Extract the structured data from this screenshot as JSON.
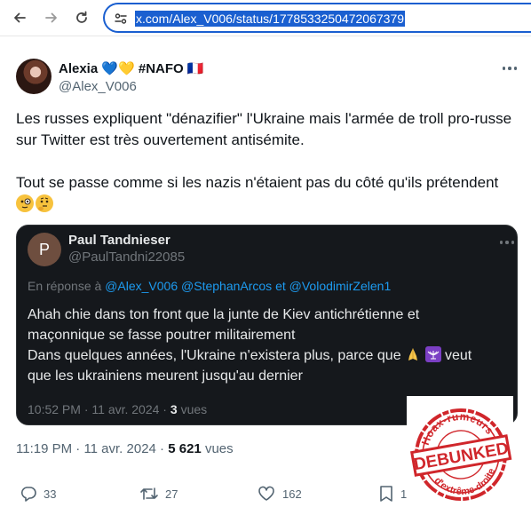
{
  "browser": {
    "url": "x.com/Alex_V006/status/1778533250472067379"
  },
  "tweet": {
    "display_name": "Alexia 💙💛 #NAFO 🇫🇷",
    "username": "@Alex_V006",
    "text_line1": "Les russes expliquent \"dénazifier\" l'Ukraine mais l'armée de troll pro-russe sur Twitter est très ouvertement antisémite.",
    "text_line2": "Tout se passe comme si les nazis n'étaient pas du côté qu'ils prétendent",
    "time": "11:19 PM",
    "date": "11 avr. 2024",
    "views_count": "5 621",
    "views_label": "vues",
    "actions": {
      "replies": "33",
      "retweets": "27",
      "likes": "162",
      "bookmarks": "1"
    }
  },
  "quoted": {
    "avatar_letter": "P",
    "display_name": "Paul Tandnieser",
    "username": "@PaulTandni22085",
    "reply_prefix": "En réponse à",
    "mentions": [
      "@Alex_V006",
      "@StephanArcos",
      "et",
      "@VolodimirZelen1"
    ],
    "text_line1": "Ahah chie dans ton front que la junte de Kiev antichrétienne et maçonnique se fasse poutrer militairement",
    "text_line2_a": "Dans quelques années, l'Ukraine n'existera plus, parce que",
    "text_line2_b": "veut que les ukrainiens meurent jusqu'au dernier",
    "time": "10:52 PM",
    "date": "11 avr. 2024",
    "views_count": "3",
    "views_label": "vues"
  },
  "stamp": {
    "top_text": "Hoax-rumeurs",
    "center_text": "DEBUNKED",
    "bottom_text": "d'extrême-droite",
    "color": "#d0262b"
  },
  "colors": {
    "url_highlight": "#1a5fd0",
    "mention": "#1d9bf0",
    "quote_bg": "#15181c",
    "secondary_text": "#536471"
  }
}
